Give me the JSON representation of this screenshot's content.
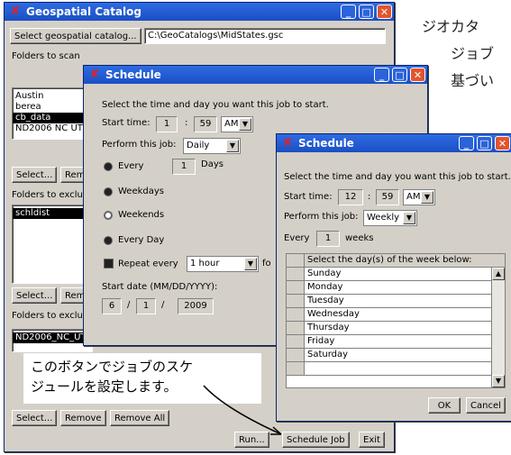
{
  "background_text": {
    "line1": "ジオカタ",
    "line2": "ジョブ",
    "line3": "基づい"
  },
  "main_window": {
    "title": "Geospatial Catalog",
    "select_catalog_label": "Select geospatial catalog...",
    "catalog_path": "C:\\GeoCatalogs\\MidStates.gsc",
    "folders_to_scan_label": "Folders to scan",
    "scan_folders": [
      "Austin",
      "berea",
      "cb_data",
      "ND2006 NC UTI"
    ],
    "select_label": "Select...",
    "remove_label": "Remo",
    "folders_to_exclude_label": "Folders to exclu",
    "exclude_folders": [
      "schldist"
    ],
    "folders_to_exclude_label2": "Folders to exclu",
    "exclude_files": [
      "ND2006_NC_UT"
    ],
    "remove_full_label": "Remove",
    "remove_all_label": "Remove All",
    "run_label": "Run...",
    "schedule_job_label": "Schedule Job",
    "exit_label": "Exit"
  },
  "callout": {
    "line1": "このボタンでジョブのスケ",
    "line2": "ジュールを設定します。"
  },
  "schedule_daily": {
    "title": "Schedule",
    "prompt": "Select the time and day you want this job to start.",
    "start_time_label": "Start time:",
    "hour": "1",
    "minute": "59",
    "ampm": "AM",
    "perform_label": "Perform this job:",
    "perform_value": "Daily",
    "every_label": "Every",
    "every_value": "1",
    "days_label": "Days",
    "weekdays_label": "Weekdays",
    "weekends_label": "Weekends",
    "every_day_label": "Every Day",
    "repeat_label": "Repeat every",
    "repeat_value": "1 hour",
    "repeat_suffix": "fo",
    "start_date_label": "Start date (MM/DD/YYYY):",
    "month": "6",
    "day": "1",
    "year": "2009"
  },
  "schedule_weekly": {
    "title": "Schedule",
    "prompt": "Select the time and day you want this job to start.",
    "start_time_label": "Start time:",
    "hour": "12",
    "minute": "59",
    "ampm": "AM",
    "perform_label": "Perform this job:",
    "perform_value": "Weekly",
    "every_label": "Every",
    "every_value": "1",
    "weeks_label": "weeks",
    "grid_header": "Select the day(s) of the week below:",
    "days": [
      "Sunday",
      "Monday",
      "Tuesday",
      "Wednesday",
      "Thursday",
      "Friday",
      "Saturday"
    ],
    "ok_label": "OK",
    "cancel_label": "Cancel"
  },
  "colors": {
    "titlebar": "#1b4fc4",
    "window_bg": "#d4d0c8",
    "close_button": "#e2552d"
  }
}
